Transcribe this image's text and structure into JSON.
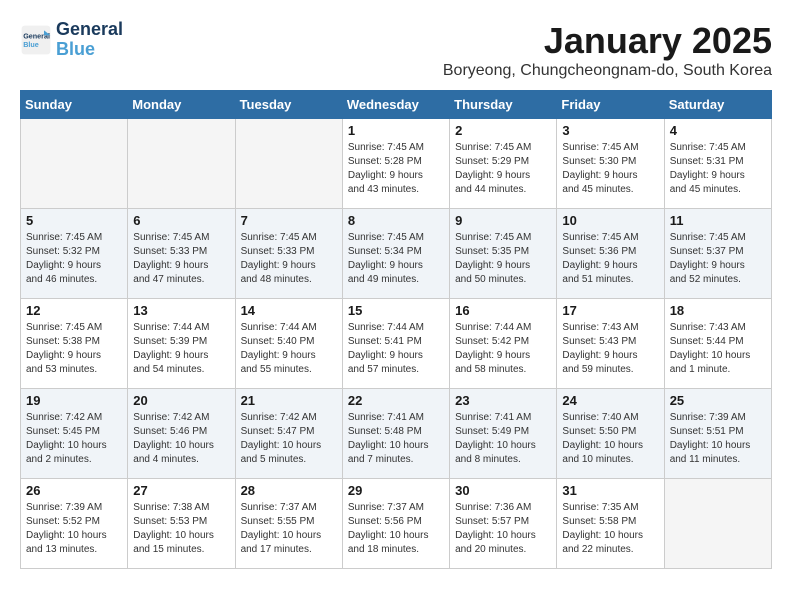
{
  "logo": {
    "line1": "General",
    "line2": "Blue"
  },
  "title": "January 2025",
  "subtitle": "Boryeong, Chungcheongnam-do, South Korea",
  "weekdays": [
    "Sunday",
    "Monday",
    "Tuesday",
    "Wednesday",
    "Thursday",
    "Friday",
    "Saturday"
  ],
  "weeks": [
    [
      {
        "day": "",
        "content": ""
      },
      {
        "day": "",
        "content": ""
      },
      {
        "day": "",
        "content": ""
      },
      {
        "day": "1",
        "content": "Sunrise: 7:45 AM\nSunset: 5:28 PM\nDaylight: 9 hours\nand 43 minutes."
      },
      {
        "day": "2",
        "content": "Sunrise: 7:45 AM\nSunset: 5:29 PM\nDaylight: 9 hours\nand 44 minutes."
      },
      {
        "day": "3",
        "content": "Sunrise: 7:45 AM\nSunset: 5:30 PM\nDaylight: 9 hours\nand 45 minutes."
      },
      {
        "day": "4",
        "content": "Sunrise: 7:45 AM\nSunset: 5:31 PM\nDaylight: 9 hours\nand 45 minutes."
      }
    ],
    [
      {
        "day": "5",
        "content": "Sunrise: 7:45 AM\nSunset: 5:32 PM\nDaylight: 9 hours\nand 46 minutes."
      },
      {
        "day": "6",
        "content": "Sunrise: 7:45 AM\nSunset: 5:33 PM\nDaylight: 9 hours\nand 47 minutes."
      },
      {
        "day": "7",
        "content": "Sunrise: 7:45 AM\nSunset: 5:33 PM\nDaylight: 9 hours\nand 48 minutes."
      },
      {
        "day": "8",
        "content": "Sunrise: 7:45 AM\nSunset: 5:34 PM\nDaylight: 9 hours\nand 49 minutes."
      },
      {
        "day": "9",
        "content": "Sunrise: 7:45 AM\nSunset: 5:35 PM\nDaylight: 9 hours\nand 50 minutes."
      },
      {
        "day": "10",
        "content": "Sunrise: 7:45 AM\nSunset: 5:36 PM\nDaylight: 9 hours\nand 51 minutes."
      },
      {
        "day": "11",
        "content": "Sunrise: 7:45 AM\nSunset: 5:37 PM\nDaylight: 9 hours\nand 52 minutes."
      }
    ],
    [
      {
        "day": "12",
        "content": "Sunrise: 7:45 AM\nSunset: 5:38 PM\nDaylight: 9 hours\nand 53 minutes."
      },
      {
        "day": "13",
        "content": "Sunrise: 7:44 AM\nSunset: 5:39 PM\nDaylight: 9 hours\nand 54 minutes."
      },
      {
        "day": "14",
        "content": "Sunrise: 7:44 AM\nSunset: 5:40 PM\nDaylight: 9 hours\nand 55 minutes."
      },
      {
        "day": "15",
        "content": "Sunrise: 7:44 AM\nSunset: 5:41 PM\nDaylight: 9 hours\nand 57 minutes."
      },
      {
        "day": "16",
        "content": "Sunrise: 7:44 AM\nSunset: 5:42 PM\nDaylight: 9 hours\nand 58 minutes."
      },
      {
        "day": "17",
        "content": "Sunrise: 7:43 AM\nSunset: 5:43 PM\nDaylight: 9 hours\nand 59 minutes."
      },
      {
        "day": "18",
        "content": "Sunrise: 7:43 AM\nSunset: 5:44 PM\nDaylight: 10 hours\nand 1 minute."
      }
    ],
    [
      {
        "day": "19",
        "content": "Sunrise: 7:42 AM\nSunset: 5:45 PM\nDaylight: 10 hours\nand 2 minutes."
      },
      {
        "day": "20",
        "content": "Sunrise: 7:42 AM\nSunset: 5:46 PM\nDaylight: 10 hours\nand 4 minutes."
      },
      {
        "day": "21",
        "content": "Sunrise: 7:42 AM\nSunset: 5:47 PM\nDaylight: 10 hours\nand 5 minutes."
      },
      {
        "day": "22",
        "content": "Sunrise: 7:41 AM\nSunset: 5:48 PM\nDaylight: 10 hours\nand 7 minutes."
      },
      {
        "day": "23",
        "content": "Sunrise: 7:41 AM\nSunset: 5:49 PM\nDaylight: 10 hours\nand 8 minutes."
      },
      {
        "day": "24",
        "content": "Sunrise: 7:40 AM\nSunset: 5:50 PM\nDaylight: 10 hours\nand 10 minutes."
      },
      {
        "day": "25",
        "content": "Sunrise: 7:39 AM\nSunset: 5:51 PM\nDaylight: 10 hours\nand 11 minutes."
      }
    ],
    [
      {
        "day": "26",
        "content": "Sunrise: 7:39 AM\nSunset: 5:52 PM\nDaylight: 10 hours\nand 13 minutes."
      },
      {
        "day": "27",
        "content": "Sunrise: 7:38 AM\nSunset: 5:53 PM\nDaylight: 10 hours\nand 15 minutes."
      },
      {
        "day": "28",
        "content": "Sunrise: 7:37 AM\nSunset: 5:55 PM\nDaylight: 10 hours\nand 17 minutes."
      },
      {
        "day": "29",
        "content": "Sunrise: 7:37 AM\nSunset: 5:56 PM\nDaylight: 10 hours\nand 18 minutes."
      },
      {
        "day": "30",
        "content": "Sunrise: 7:36 AM\nSunset: 5:57 PM\nDaylight: 10 hours\nand 20 minutes."
      },
      {
        "day": "31",
        "content": "Sunrise: 7:35 AM\nSunset: 5:58 PM\nDaylight: 10 hours\nand 22 minutes."
      },
      {
        "day": "",
        "content": ""
      }
    ]
  ]
}
